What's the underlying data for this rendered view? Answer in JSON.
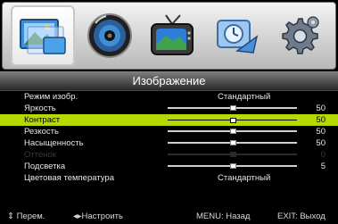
{
  "menu": {
    "icons": [
      {
        "name": "picture-icon",
        "selected": true
      },
      {
        "name": "sound-icon",
        "selected": false
      },
      {
        "name": "tv-channel-icon",
        "selected": false
      },
      {
        "name": "timer-satellite-icon",
        "selected": false
      },
      {
        "name": "settings-gear-icon",
        "selected": false
      }
    ],
    "title": "Изображение"
  },
  "rows": [
    {
      "label": "Режим изобр.",
      "value": "Стандартный",
      "kind": "text"
    },
    {
      "label": "Яркость",
      "value": "50",
      "kind": "slider",
      "level": 0.5
    },
    {
      "label": "Контраст",
      "value": "50",
      "kind": "slider",
      "level": 0.5,
      "highlight": true
    },
    {
      "label": "Резкость",
      "value": "50",
      "kind": "slider",
      "level": 0.5
    },
    {
      "label": "Насыщенность",
      "value": "50",
      "kind": "slider",
      "level": 0.5
    },
    {
      "label": "Оттенок",
      "value": "0",
      "kind": "slider",
      "level": 0.5,
      "disabled": true
    },
    {
      "label": "Подсветка",
      "value": "5",
      "kind": "slider",
      "level": 0.5
    },
    {
      "label": "Цветовая температура",
      "value": "Стандартный",
      "kind": "text"
    }
  ],
  "footer": {
    "move": "⇕ Перем.",
    "adjust": "◂▸Настроить",
    "back": "MENU: Назад",
    "exit": "EXIT: Выход"
  },
  "colors": {
    "highlight": "#b8d900",
    "background": "#000000",
    "text": "#e6e6e6"
  }
}
